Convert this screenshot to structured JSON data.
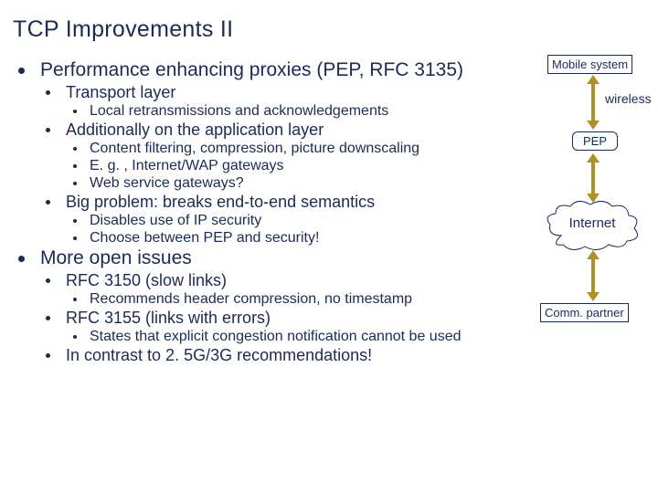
{
  "title": "TCP Improvements II",
  "b": {
    "pep": "Performance enhancing proxies (PEP, RFC 3135)",
    "transport": "Transport layer",
    "local_retrans": "Local retransmissions and acknowledgements",
    "addition_app": "Additionally on the application layer",
    "content_filter": "Content filtering, compression, picture downscaling",
    "eg_gateways": "E. g. , Internet/WAP gateways",
    "web_svc": "Web service gateways?",
    "big_problem": "Big problem: breaks end-to-end semantics",
    "disables_ipsec": "Disables use of IP security",
    "choose": "Choose between PEP and security!",
    "more_open": "More open issues",
    "rfc3150": "RFC 3150 (slow links)",
    "recommends": "Recommends header compression, no timestamp",
    "rfc3155": "RFC 3155 (links with errors)",
    "states_ecn": "States that explicit congestion notification cannot be used",
    "contrast": "In contrast to 2. 5G/3G recommendations!"
  },
  "diagram": {
    "mobile": "Mobile system",
    "wireless": "wireless",
    "pep_node": "PEP",
    "internet": "Internet",
    "comm_partner": "Comm. partner"
  }
}
